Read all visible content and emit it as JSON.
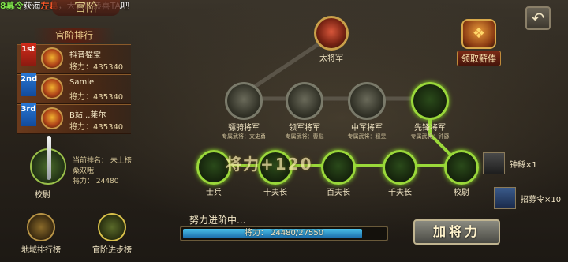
{
  "ticker": {
    "prefix": "8募令",
    "mid": "获海",
    "name": "左葛",
    "tail": "大家快恭喜TA吧"
  },
  "page_title": "官阶",
  "back_icon": "back-arrow-icon",
  "salary": {
    "label": "领取薪俸",
    "icon": "treasure-chest-icon"
  },
  "ranking": {
    "title": "官阶排行",
    "entries": [
      {
        "badge": "1st",
        "name": "抖音猫宝",
        "power_label": "将力：",
        "power": "435340"
      },
      {
        "badge": "2nd",
        "name": "Samle",
        "power_label": "将力：",
        "power": "435340"
      },
      {
        "badge": "3rd",
        "name": "B站...莱尔",
        "power_label": "将力：",
        "power": "435340"
      }
    ]
  },
  "me": {
    "rank_label": "校尉",
    "line1": "当前排名： 未上榜",
    "line2": "桑双哦",
    "line3": "将力： 24480"
  },
  "bottom_buttons": [
    {
      "label": "地域排行榜",
      "icon": "globe-icon"
    },
    {
      "label": "官阶进步榜",
      "icon": "crossed-swords-icon"
    }
  ],
  "tree": {
    "top": {
      "label": "太将军"
    },
    "generals": [
      {
        "label": "骠骑将军",
        "sub": "专属武将：文史勇"
      },
      {
        "label": "领军将军",
        "sub": "专属武将：曹彪"
      },
      {
        "label": "中军将军",
        "sub": "专属武将：程昱"
      },
      {
        "label": "先锋将军",
        "sub": "专属武将：钟繇"
      }
    ],
    "ranks": [
      {
        "label": "士兵"
      },
      {
        "label": "十夫长"
      },
      {
        "label": "百夫长"
      },
      {
        "label": "千夫长"
      },
      {
        "label": "校尉"
      }
    ],
    "overlay_text": "将力+120"
  },
  "progress": {
    "title": "努力进阶中...",
    "label": "将力：",
    "value": "24480/27550",
    "fraction": 0.8886
  },
  "add_power_button": "加将力",
  "rewards": [
    {
      "text": "钟繇×1",
      "icon": "general-portrait-icon"
    },
    {
      "text": "招募令×10",
      "icon": "recruit-token-icon"
    }
  ]
}
